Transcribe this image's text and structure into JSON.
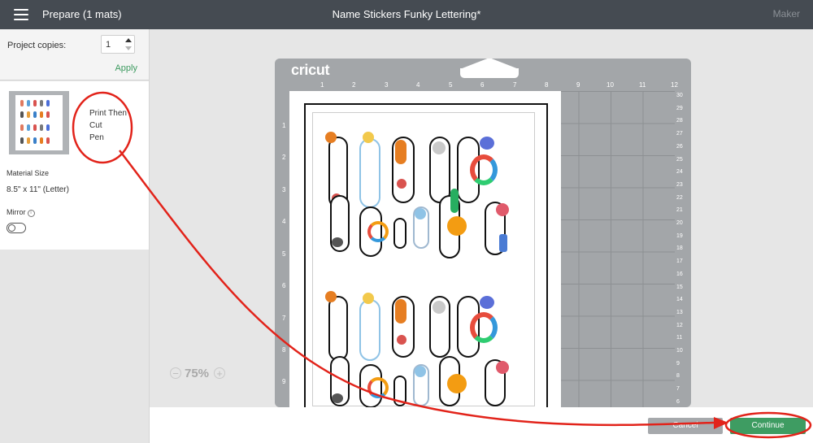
{
  "topbar": {
    "menu_icon": "hamburger-menu-icon",
    "title": "Prepare (1 mats)",
    "project_name": "Name Stickers Funky Lettering*",
    "right_label": "Maker"
  },
  "sidebar": {
    "copies_label": "Project copies:",
    "copies_value": "1",
    "apply_label": "Apply",
    "mat": {
      "mode_lines": [
        "Print Then",
        "Cut",
        "Pen"
      ],
      "material_size_label": "Material Size",
      "material_size": "8.5\" x 11\" (Letter)",
      "mirror_label": "Mirror",
      "mirror_on": false
    }
  },
  "mat_canvas": {
    "brand": "cricut",
    "top_ruler": [
      "1",
      "2",
      "3",
      "4",
      "5",
      "6",
      "7",
      "8",
      "9",
      "10",
      "11",
      "12"
    ],
    "left_ruler": [
      "1",
      "2",
      "3",
      "4",
      "5",
      "6",
      "7",
      "8",
      "9"
    ],
    "right_ruler": [
      "30",
      "29",
      "28",
      "27",
      "26",
      "25",
      "24",
      "23",
      "22",
      "21",
      "20",
      "19",
      "18",
      "17",
      "16",
      "15",
      "14",
      "13",
      "12",
      "11",
      "10",
      "9",
      "8",
      "7",
      "6"
    ]
  },
  "zoom": {
    "value": "75%",
    "minus": "−",
    "plus": "+"
  },
  "footer": {
    "cancel_label": "Cancel",
    "continue_label": "Continue"
  },
  "colors": {
    "topbar": "#454b52",
    "accent_green": "#3e9c62",
    "annotation_red": "#e2231a",
    "mat_grey": "#a3a6a9"
  }
}
